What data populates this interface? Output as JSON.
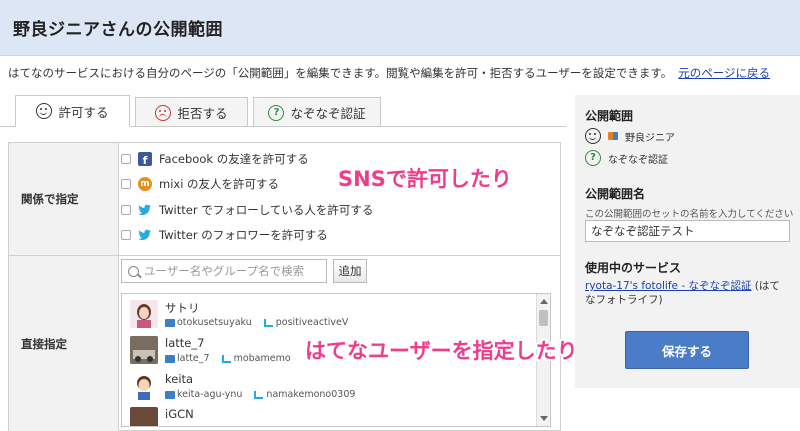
{
  "header": {
    "title": "野良ジニアさんの公開範囲"
  },
  "intro": {
    "text": "はてなのサービスにおける自分のページの「公開範囲」を編集できます。閲覧や編集を許可・拒否するユーザーを設定できます。",
    "back_link": "元のページに戻る"
  },
  "tabs": [
    {
      "label": "許可する",
      "icon": "smile-icon",
      "active": true
    },
    {
      "label": "拒否する",
      "icon": "sad-icon",
      "active": false
    },
    {
      "label": "なぞなぞ認証",
      "icon": "question-icon",
      "active": false
    }
  ],
  "relation": {
    "label": "関係で指定",
    "options": [
      {
        "label": "Facebook の友達を許可する",
        "icon": "facebook-icon"
      },
      {
        "label": "mixi の友人を許可する",
        "icon": "mixi-icon"
      },
      {
        "label": "Twitter でフォローしている人を許可する",
        "icon": "twitter-icon"
      },
      {
        "label": "Twitter のフォロワーを許可する",
        "icon": "twitter-icon"
      }
    ]
  },
  "direct": {
    "label": "直接指定",
    "search_placeholder": "ユーザー名やグループ名で検索",
    "add_button": "追加",
    "users": [
      {
        "name": "サトリ",
        "hatena": "otokusetsuyaku",
        "twitter": "positiveactiveV"
      },
      {
        "name": "latte_7",
        "hatena": "latte_7",
        "twitter": "mobamemo"
      },
      {
        "name": "keita",
        "hatena": "keita-agu-ynu",
        "twitter": "namakemono0309"
      },
      {
        "name": "iGCN",
        "hatena": "",
        "twitter": ""
      }
    ]
  },
  "callouts": {
    "sns": "SNSで許可したり",
    "hatena": "はてなユーザーを指定したり"
  },
  "sidebar": {
    "scope_title": "公開範囲",
    "scope_user": "野良ジニア",
    "scope_riddle": "なぞなぞ認証",
    "name_title": "公開範囲名",
    "name_hint": "この公開範囲のセットの名前を入力してください",
    "name_value": "なぞなぞ認証テスト",
    "service_title": "使用中のサービス",
    "service_link": "ryota-17's fotolife - なぞなぞ認証",
    "service_suffix": " (はてなフォトライフ)",
    "save_button": "保存する"
  },
  "colors": {
    "header_bg": "#dde6f5",
    "accent": "#4a7cc7",
    "callout": "#f03c8c"
  }
}
